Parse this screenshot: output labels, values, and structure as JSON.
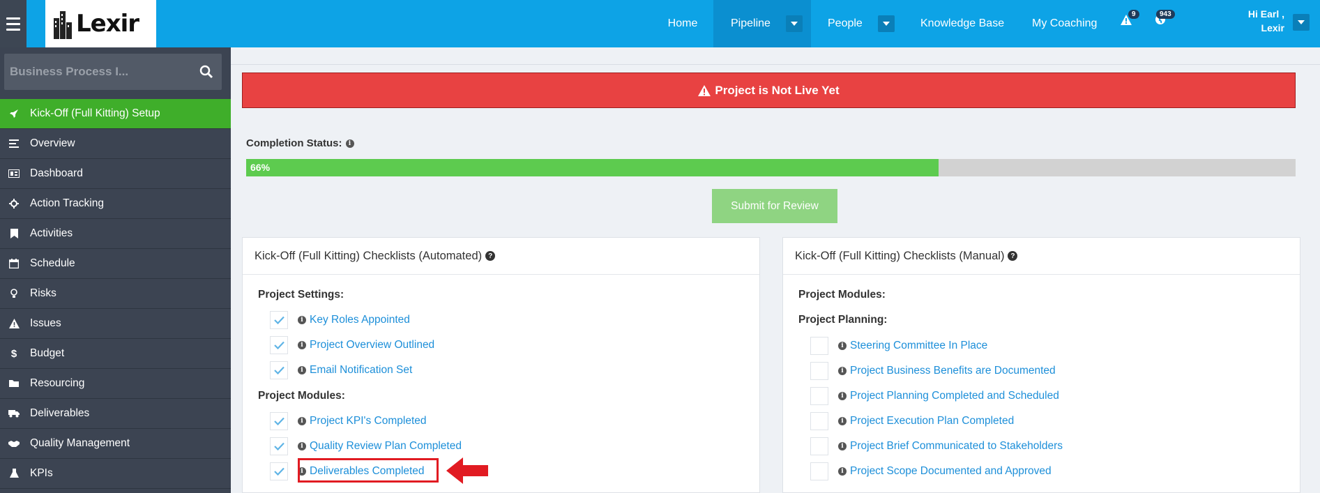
{
  "header": {
    "logo_text": "Lexir",
    "nav": [
      {
        "label": "Home"
      },
      {
        "label": "Pipeline"
      },
      {
        "label": "People"
      },
      {
        "label": "Knowledge Base"
      },
      {
        "label": "My Coaching"
      }
    ],
    "alerts_count": "9",
    "notifications_count": "943",
    "greeting_line1": "Hi Earl ,",
    "greeting_line2": "Lexir"
  },
  "sidebar": {
    "search_placeholder": "Business Process I...",
    "items": [
      {
        "label": "Kick-Off (Full Kitting) Setup",
        "icon": "rocket-icon",
        "active": true
      },
      {
        "label": "Overview",
        "icon": "list-icon"
      },
      {
        "label": "Dashboard",
        "icon": "dashboard-icon"
      },
      {
        "label": "Action Tracking",
        "icon": "crosshairs-icon"
      },
      {
        "label": "Activities",
        "icon": "bookmark-icon"
      },
      {
        "label": "Schedule",
        "icon": "calendar-icon"
      },
      {
        "label": "Risks",
        "icon": "lightbulb-icon"
      },
      {
        "label": "Issues",
        "icon": "warning-icon"
      },
      {
        "label": "Budget",
        "icon": "dollar-icon"
      },
      {
        "label": "Resourcing",
        "icon": "folder-icon"
      },
      {
        "label": "Deliverables",
        "icon": "truck-icon"
      },
      {
        "label": "Quality Management",
        "icon": "handshake-icon"
      },
      {
        "label": "KPIs",
        "icon": "flask-icon"
      }
    ]
  },
  "main": {
    "alert_text": "Project is Not Live Yet",
    "completion_label": "Completion Status:",
    "progress_percent": 66,
    "progress_text": "66%",
    "submit_label": "Submit for Review",
    "automated": {
      "title": "Kick-Off (Full Kitting) Checklists (Automated)",
      "section1": "Project Settings:",
      "settings_items": [
        "Key Roles Appointed",
        "Project Overview Outlined",
        "Email Notification Set"
      ],
      "section2": "Project Modules:",
      "module_items": [
        "Project KPI's Completed",
        "Quality Review Plan Completed",
        "Deliverables Completed"
      ]
    },
    "manual": {
      "title": "Kick-Off (Full Kitting) Checklists (Manual)",
      "section1": "Project Modules:",
      "section2": "Project Planning:",
      "planning_items": [
        "Steering Committee In Place",
        "Project Business Benefits are Documented",
        "Project Planning Completed and Scheduled",
        "Project Execution Plan Completed",
        "Project Brief Communicated to Stakeholders",
        "Project Scope Documented and Approved"
      ]
    }
  },
  "colors": {
    "topbar": "#0da3e6",
    "sidebar": "#3c4452",
    "active_menu": "#3fae2a",
    "alert": "#e84242",
    "progress_fill": "#5dcb4f",
    "highlight": "#e11b22"
  }
}
